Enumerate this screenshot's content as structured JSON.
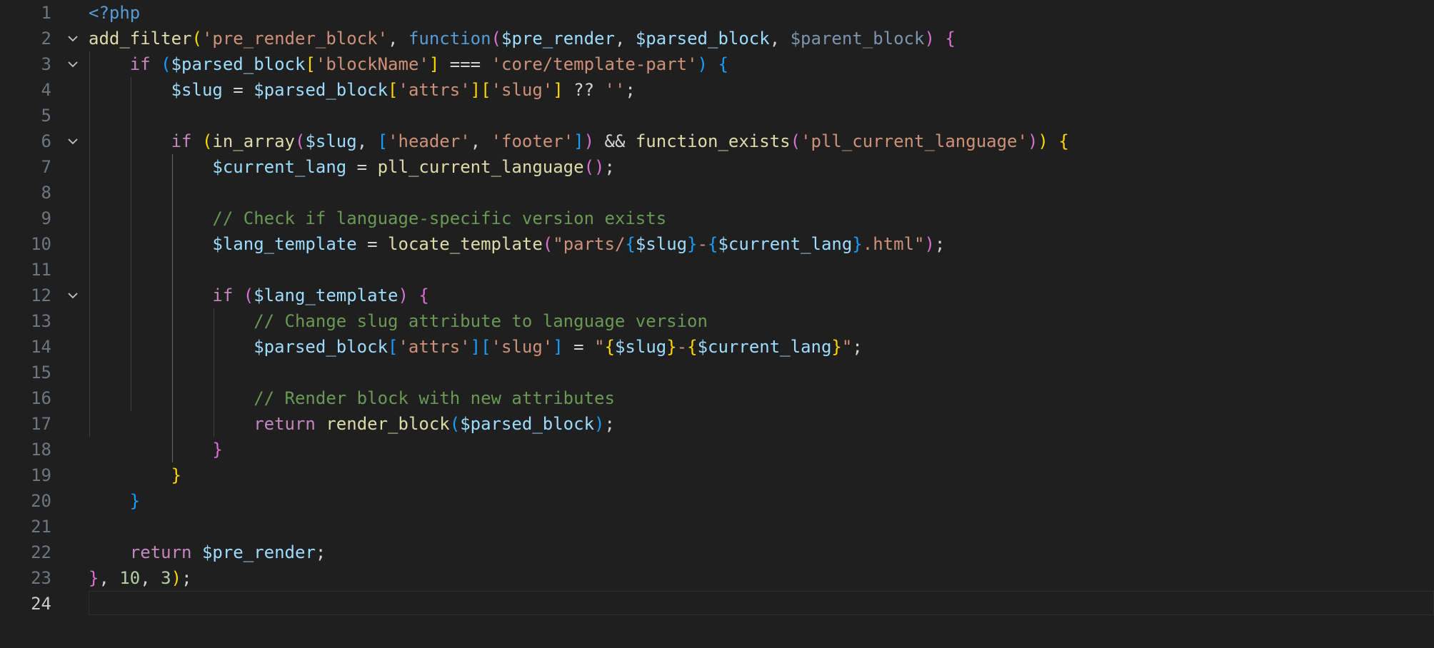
{
  "editor": {
    "language": "php",
    "active_line": 24,
    "colors": {
      "background": "#1f1f1f",
      "line_number": "#6e7681",
      "keyword": "#569cd6",
      "function": "#dcdcaa",
      "string": "#ce9178",
      "variable": "#9cdcfe",
      "comment": "#6a9955",
      "control": "#c586c0",
      "bracket_1": "#ffd700",
      "bracket_2": "#da70d6",
      "bracket_3": "#179fff"
    },
    "lines": [
      {
        "n": "1",
        "fold": false,
        "tokens": [
          [
            "t-tag",
            "<?php"
          ]
        ]
      },
      {
        "n": "2",
        "fold": true,
        "tokens": [
          [
            "t-fn",
            "add_filter"
          ],
          [
            "t-p1",
            "("
          ],
          [
            "t-str",
            "'pre_render_block'"
          ],
          [
            "t-txt",
            ", "
          ],
          [
            "t-kw",
            "function"
          ],
          [
            "t-p2",
            "("
          ],
          [
            "t-var",
            "$pre_render"
          ],
          [
            "t-txt",
            ", "
          ],
          [
            "t-var",
            "$parsed_block"
          ],
          [
            "t-txt",
            ", "
          ],
          [
            "t-dim",
            "$parent_block"
          ],
          [
            "t-p2",
            ")"
          ],
          [
            "t-txt",
            " "
          ],
          [
            "t-p2",
            "{"
          ]
        ]
      },
      {
        "n": "3",
        "fold": true,
        "tokens": [
          [
            "t-txt",
            "    "
          ],
          [
            "t-ctrl",
            "if"
          ],
          [
            "t-txt",
            " "
          ],
          [
            "t-p3",
            "("
          ],
          [
            "t-var",
            "$parsed_block"
          ],
          [
            "t-p1",
            "["
          ],
          [
            "t-str",
            "'blockName'"
          ],
          [
            "t-p1",
            "]"
          ],
          [
            "t-txt",
            " === "
          ],
          [
            "t-str",
            "'core/template-part'"
          ],
          [
            "t-p3",
            ")"
          ],
          [
            "t-txt",
            " "
          ],
          [
            "t-p3",
            "{"
          ]
        ]
      },
      {
        "n": "4",
        "fold": false,
        "tokens": [
          [
            "t-txt",
            "        "
          ],
          [
            "t-var",
            "$slug"
          ],
          [
            "t-txt",
            " = "
          ],
          [
            "t-var",
            "$parsed_block"
          ],
          [
            "t-p1",
            "["
          ],
          [
            "t-str",
            "'attrs'"
          ],
          [
            "t-p1",
            "]"
          ],
          [
            "t-p1",
            "["
          ],
          [
            "t-str",
            "'slug'"
          ],
          [
            "t-p1",
            "]"
          ],
          [
            "t-txt",
            " ?? "
          ],
          [
            "t-str",
            "''"
          ],
          [
            "t-txt",
            ";"
          ]
        ]
      },
      {
        "n": "5",
        "fold": false,
        "tokens": []
      },
      {
        "n": "6",
        "fold": true,
        "tokens": [
          [
            "t-txt",
            "        "
          ],
          [
            "t-ctrl",
            "if"
          ],
          [
            "t-txt",
            " "
          ],
          [
            "t-p1",
            "("
          ],
          [
            "t-fn",
            "in_array"
          ],
          [
            "t-p2",
            "("
          ],
          [
            "t-var",
            "$slug"
          ],
          [
            "t-txt",
            ", "
          ],
          [
            "t-p3",
            "["
          ],
          [
            "t-str",
            "'header'"
          ],
          [
            "t-txt",
            ", "
          ],
          [
            "t-str",
            "'footer'"
          ],
          [
            "t-p3",
            "]"
          ],
          [
            "t-p2",
            ")"
          ],
          [
            "t-txt",
            " && "
          ],
          [
            "t-fn",
            "function_exists"
          ],
          [
            "t-p2",
            "("
          ],
          [
            "t-str",
            "'pll_current_language'"
          ],
          [
            "t-p2",
            ")"
          ],
          [
            "t-p1",
            ")"
          ],
          [
            "t-txt",
            " "
          ],
          [
            "t-p1",
            "{"
          ]
        ]
      },
      {
        "n": "7",
        "fold": false,
        "tokens": [
          [
            "t-txt",
            "            "
          ],
          [
            "t-var",
            "$current_lang"
          ],
          [
            "t-txt",
            " = "
          ],
          [
            "t-fn",
            "pll_current_language"
          ],
          [
            "t-p2",
            "()"
          ],
          [
            "t-txt",
            ";"
          ]
        ]
      },
      {
        "n": "8",
        "fold": false,
        "tokens": []
      },
      {
        "n": "9",
        "fold": false,
        "tokens": [
          [
            "t-txt",
            "            "
          ],
          [
            "t-cmt",
            "// Check if language-specific version exists"
          ]
        ]
      },
      {
        "n": "10",
        "fold": false,
        "tokens": [
          [
            "t-txt",
            "            "
          ],
          [
            "t-var",
            "$lang_template"
          ],
          [
            "t-txt",
            " = "
          ],
          [
            "t-fn",
            "locate_template"
          ],
          [
            "t-p2",
            "("
          ],
          [
            "t-str",
            "\"parts/"
          ],
          [
            "t-p3",
            "{"
          ],
          [
            "t-var",
            "$slug"
          ],
          [
            "t-p3",
            "}"
          ],
          [
            "t-str",
            "-"
          ],
          [
            "t-p3",
            "{"
          ],
          [
            "t-var",
            "$current_lang"
          ],
          [
            "t-p3",
            "}"
          ],
          [
            "t-str",
            ".html\""
          ],
          [
            "t-p2",
            ")"
          ],
          [
            "t-txt",
            ";"
          ]
        ]
      },
      {
        "n": "11",
        "fold": false,
        "tokens": []
      },
      {
        "n": "12",
        "fold": true,
        "tokens": [
          [
            "t-txt",
            "            "
          ],
          [
            "t-ctrl",
            "if"
          ],
          [
            "t-txt",
            " "
          ],
          [
            "t-p2",
            "("
          ],
          [
            "t-var",
            "$lang_template"
          ],
          [
            "t-p2",
            ")"
          ],
          [
            "t-txt",
            " "
          ],
          [
            "t-p2",
            "{"
          ]
        ]
      },
      {
        "n": "13",
        "fold": false,
        "tokens": [
          [
            "t-txt",
            "                "
          ],
          [
            "t-cmt",
            "// Change slug attribute to language version"
          ]
        ]
      },
      {
        "n": "14",
        "fold": false,
        "tokens": [
          [
            "t-txt",
            "                "
          ],
          [
            "t-var",
            "$parsed_block"
          ],
          [
            "t-p3",
            "["
          ],
          [
            "t-str",
            "'attrs'"
          ],
          [
            "t-p3",
            "]"
          ],
          [
            "t-p3",
            "["
          ],
          [
            "t-str",
            "'slug'"
          ],
          [
            "t-p3",
            "]"
          ],
          [
            "t-txt",
            " = "
          ],
          [
            "t-str",
            "\""
          ],
          [
            "t-p1",
            "{"
          ],
          [
            "t-var",
            "$slug"
          ],
          [
            "t-p1",
            "}"
          ],
          [
            "t-str",
            "-"
          ],
          [
            "t-p1",
            "{"
          ],
          [
            "t-var",
            "$current_lang"
          ],
          [
            "t-p1",
            "}"
          ],
          [
            "t-str",
            "\""
          ],
          [
            "t-txt",
            ";"
          ]
        ]
      },
      {
        "n": "15",
        "fold": false,
        "tokens": []
      },
      {
        "n": "16",
        "fold": false,
        "tokens": [
          [
            "t-txt",
            "                "
          ],
          [
            "t-cmt",
            "// Render block with new attributes"
          ]
        ]
      },
      {
        "n": "17",
        "fold": false,
        "tokens": [
          [
            "t-txt",
            "                "
          ],
          [
            "t-ctrl",
            "return"
          ],
          [
            "t-txt",
            " "
          ],
          [
            "t-fn",
            "render_block"
          ],
          [
            "t-p3",
            "("
          ],
          [
            "t-var",
            "$parsed_block"
          ],
          [
            "t-p3",
            ")"
          ],
          [
            "t-txt",
            ";"
          ]
        ]
      },
      {
        "n": "18",
        "fold": false,
        "tokens": [
          [
            "t-txt",
            "            "
          ],
          [
            "t-p2",
            "}"
          ]
        ]
      },
      {
        "n": "19",
        "fold": false,
        "tokens": [
          [
            "t-txt",
            "        "
          ],
          [
            "t-p1",
            "}"
          ]
        ]
      },
      {
        "n": "20",
        "fold": false,
        "tokens": [
          [
            "t-txt",
            "    "
          ],
          [
            "t-p3",
            "}"
          ]
        ]
      },
      {
        "n": "21",
        "fold": false,
        "tokens": []
      },
      {
        "n": "22",
        "fold": false,
        "tokens": [
          [
            "t-txt",
            "    "
          ],
          [
            "t-ctrl",
            "return"
          ],
          [
            "t-txt",
            " "
          ],
          [
            "t-var",
            "$pre_render"
          ],
          [
            "t-txt",
            ";"
          ]
        ]
      },
      {
        "n": "23",
        "fold": false,
        "tokens": [
          [
            "t-p2",
            "}"
          ],
          [
            "t-txt",
            ", "
          ],
          [
            "t-num",
            "10"
          ],
          [
            "t-txt",
            ", "
          ],
          [
            "t-num",
            "3"
          ],
          [
            "t-p1",
            ")"
          ],
          [
            "t-txt",
            ";"
          ]
        ]
      },
      {
        "n": "24",
        "fold": false,
        "tokens": []
      }
    ]
  }
}
